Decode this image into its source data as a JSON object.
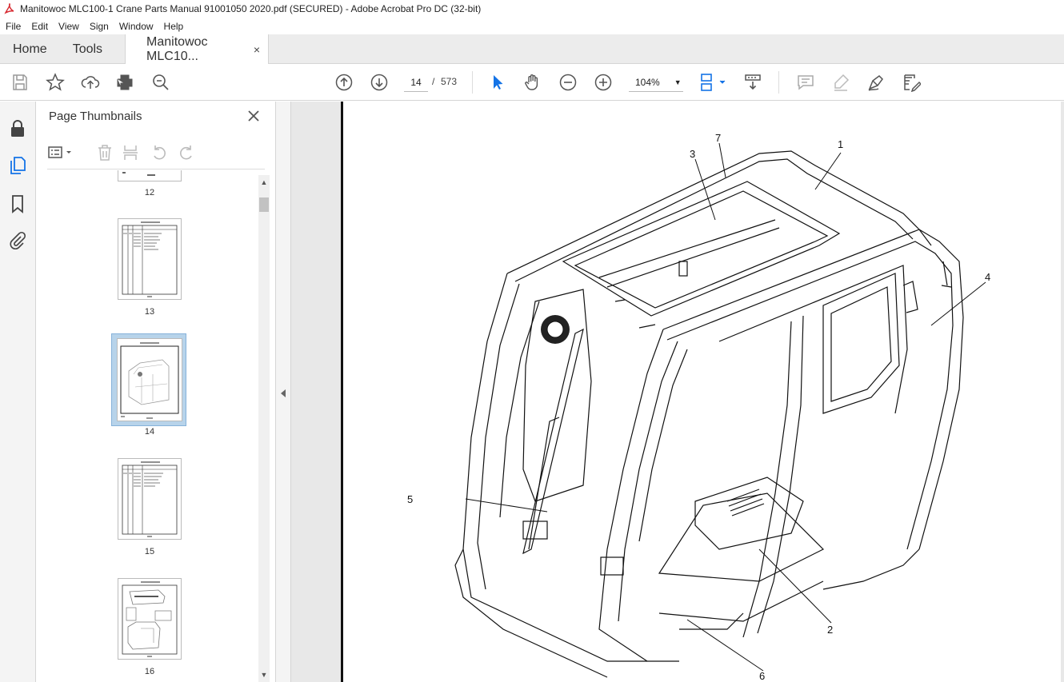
{
  "window": {
    "title": "Manitowoc MLC100-1 Crane Parts Manual 91001050 2020.pdf (SECURED) - Adobe Acrobat Pro DC (32-bit)"
  },
  "menu": [
    "File",
    "Edit",
    "View",
    "Sign",
    "Window",
    "Help"
  ],
  "tabs": {
    "home": "Home",
    "tools": "Tools",
    "document": "Manitowoc MLC10...",
    "close": "×"
  },
  "toolbar": {
    "current_page": "14",
    "page_separator": "/",
    "total_pages": "573",
    "zoom": "104%"
  },
  "thumbnails_panel": {
    "title": "Page Thumbnails",
    "close": "✕",
    "pages": [
      {
        "label": "12",
        "selected": false
      },
      {
        "label": "13",
        "selected": false
      },
      {
        "label": "14",
        "selected": true
      },
      {
        "label": "15",
        "selected": false
      },
      {
        "label": "16",
        "selected": false
      }
    ]
  },
  "drawing": {
    "callouts": [
      "1",
      "2",
      "3",
      "4",
      "5",
      "6",
      "7"
    ]
  },
  "colors": {
    "accent": "#1473e6",
    "selected_thumb": "#b7d3ea",
    "panel_bg": "#f4f4f4"
  }
}
